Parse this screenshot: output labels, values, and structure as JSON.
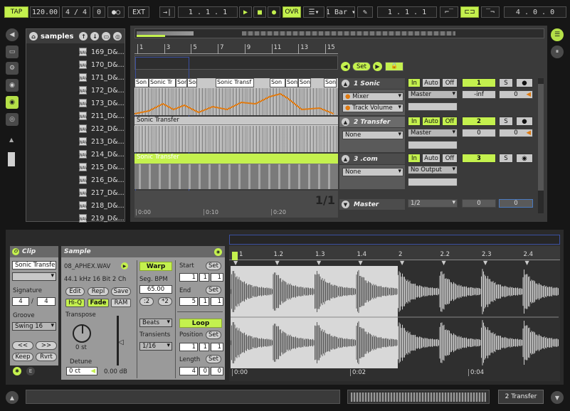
{
  "transport": {
    "tap": "TAP",
    "tempo": "120.00",
    "signature": "4 / 4",
    "nudge": "0",
    "ext": "EXT",
    "position": "1 .   1 .   1",
    "ovr": "OVR",
    "quantize": "1 Bar",
    "loop_start": "1 .   1 .   1",
    "loop_length": "4 .   0 .   0"
  },
  "browser": {
    "title": "samples",
    "files": [
      "169_D&...",
      "170_D&...",
      "171_D&...",
      "172_D&...",
      "173_D&...",
      "211_D&...",
      "212_D&...",
      "213_D&...",
      "214_D&...",
      "215_D&...",
      "216_D&...",
      "217_D&...",
      "218_D&...",
      "219_D&..."
    ]
  },
  "arrangement": {
    "ruler": [
      "1",
      "3",
      "5",
      "7",
      "9",
      "11",
      "13",
      "15"
    ],
    "set_label": "Set",
    "clip_names_1": [
      "Son",
      "Sonic Tr",
      "Son",
      "Son",
      "Sonic Transf",
      "Son",
      "Son",
      "Son",
      "Son"
    ],
    "clip_name_2": "Sonic Transfer",
    "clip_name_3": "Sonic Transfer",
    "page_indicator": "1/1",
    "time_labels": [
      "0:00",
      "0:10",
      "0:20"
    ]
  },
  "tracks": [
    {
      "name": "1 Sonic",
      "in": "In",
      "auto": "Auto",
      "off": "Off",
      "dev1": "Mixer",
      "dev2": "Track Volume",
      "out": "Master",
      "num": "1",
      "solo": "S",
      "vol": "-inf",
      "pan": "0"
    },
    {
      "name": "2 Transfer",
      "in": "In",
      "auto": "Auto",
      "off": "Off",
      "dev1": "None",
      "out": "Master",
      "num": "2",
      "solo": "S",
      "vol": "0",
      "pan": "0"
    },
    {
      "name": "3 .com",
      "in": "In",
      "auto": "Auto",
      "off": "Off",
      "dev1": "None",
      "out": "No Output",
      "num": "3",
      "solo": "S"
    }
  ],
  "master": {
    "name": "Master",
    "out": "1/2",
    "vol": "0",
    "pan": "0"
  },
  "clip_panel": {
    "title": "Clip",
    "name": "Sonic Transfe",
    "signature_label": "Signature",
    "sig_num": "4",
    "sig_den": "4",
    "groove_label": "Groove",
    "groove": "Swing 16",
    "prev": "<<",
    "next": ">>",
    "keep": "Keep",
    "rvrt": "Rvrt"
  },
  "sample_panel": {
    "title": "Sample",
    "filename": "08_APHEX.WAV",
    "format": "44.1 kHz 16 Bit 2 Ch",
    "edit": "Edit",
    "repl": "Repl",
    "save": "Save",
    "hiq": "Hi-Q",
    "fade": "Fade",
    "ram": "RAM",
    "transpose_label": "Transpose",
    "transpose_value": "0 st",
    "detune_label": "Detune",
    "detune_value": "0 ct",
    "gain_value": "0.00 dB",
    "warp": "Warp",
    "seg_bpm_label": "Seg. BPM",
    "seg_bpm": "65.00",
    "half": ":2",
    "double": "*2",
    "warp_mode": "Beats",
    "transients_label": "Transients",
    "transients": "1/16",
    "start_label": "Start",
    "end_label": "End",
    "set": "Set",
    "loop": "Loop",
    "position_label": "Position",
    "length_label": "Length",
    "start_vals": [
      "1",
      "1",
      "1"
    ],
    "end_vals": [
      "5",
      "1",
      "1"
    ],
    "pos_vals": [
      "1",
      "1",
      "1"
    ],
    "len_vals": [
      "4",
      "0",
      "0"
    ]
  },
  "sample_editor": {
    "ruler": [
      "1",
      "1.2",
      "1.3",
      "1.4",
      "2",
      "2.2",
      "2.3",
      "2.4"
    ],
    "time_labels": [
      "0:00",
      "0:02",
      "0:04"
    ]
  },
  "status": {
    "track": "2 Transfer"
  }
}
